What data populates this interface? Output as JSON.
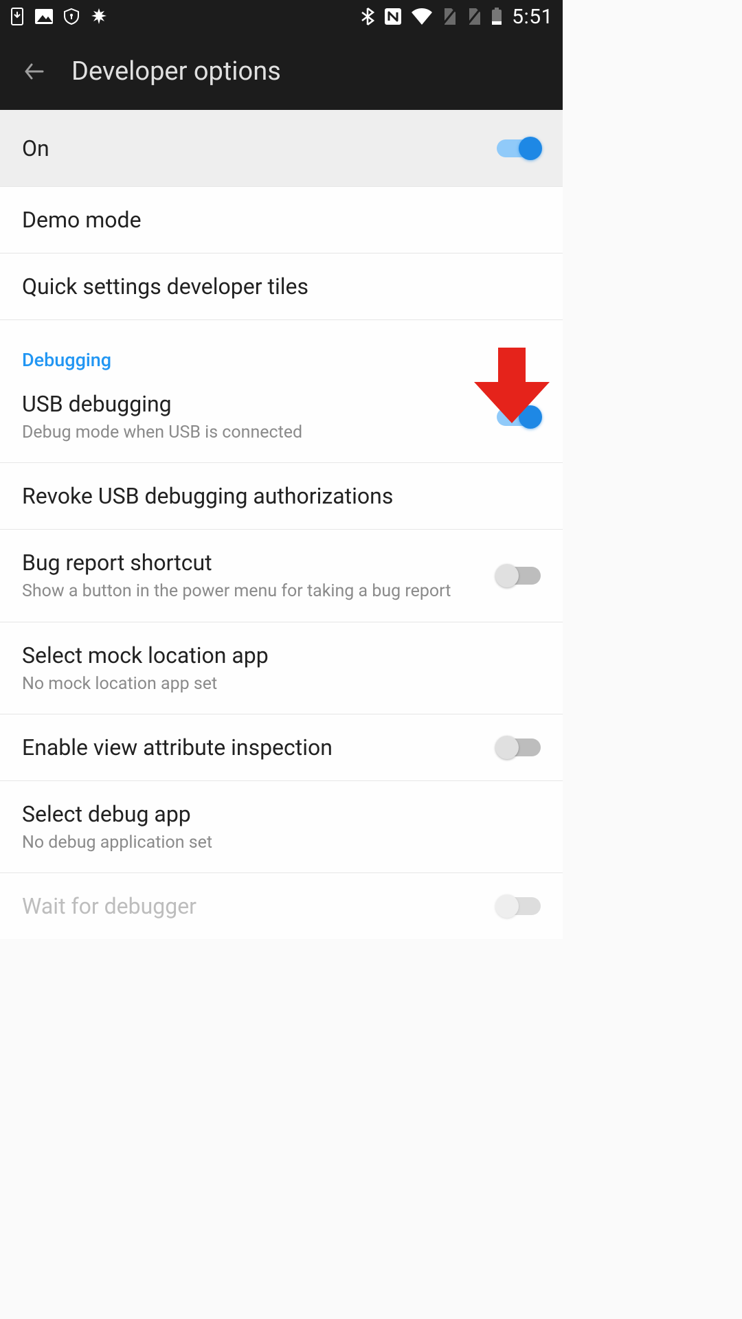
{
  "status_bar": {
    "clock": "5:51"
  },
  "app_bar": {
    "title": "Developer options"
  },
  "master_switch": {
    "label": "On",
    "on": true
  },
  "rows": {
    "demo_mode": {
      "title": "Demo mode"
    },
    "quick_tiles": {
      "title": "Quick settings developer tiles"
    },
    "section_debugging": {
      "label": "Debugging"
    },
    "usb_debugging": {
      "title": "USB debugging",
      "subtitle": "Debug mode when USB is connected",
      "on": true
    },
    "revoke_usb": {
      "title": "Revoke USB debugging authorizations"
    },
    "bug_report_shortcut": {
      "title": "Bug report shortcut",
      "subtitle": "Show a button in the power menu for taking a bug report",
      "on": false
    },
    "mock_location": {
      "title": "Select mock location app",
      "subtitle": "No mock location app set"
    },
    "view_attr": {
      "title": "Enable view attribute inspection",
      "on": false
    },
    "select_debug_app": {
      "title": "Select debug app",
      "subtitle": "No debug application set"
    },
    "wait_for_debugger": {
      "title": "Wait for debugger",
      "disabled": true
    }
  },
  "colors": {
    "accent": "#1e88e5",
    "section": "#2196f3",
    "arrow": "#e5231b"
  }
}
